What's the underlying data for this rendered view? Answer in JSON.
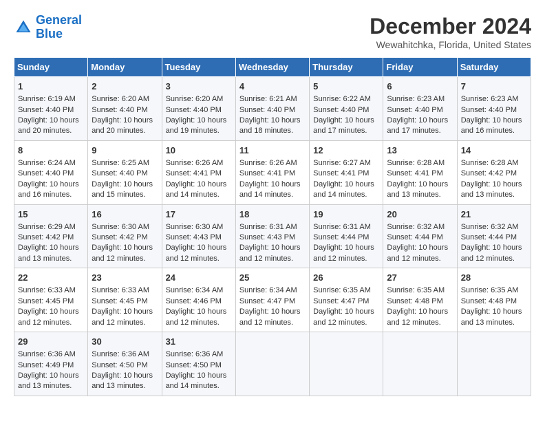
{
  "logo": {
    "line1": "General",
    "line2": "Blue"
  },
  "title": "December 2024",
  "subtitle": "Wewahitchka, Florida, United States",
  "columns": [
    "Sunday",
    "Monday",
    "Tuesday",
    "Wednesday",
    "Thursday",
    "Friday",
    "Saturday"
  ],
  "weeks": [
    [
      {
        "day": "1",
        "lines": [
          "Sunrise: 6:19 AM",
          "Sunset: 4:40 PM",
          "Daylight: 10 hours",
          "and 20 minutes."
        ]
      },
      {
        "day": "2",
        "lines": [
          "Sunrise: 6:20 AM",
          "Sunset: 4:40 PM",
          "Daylight: 10 hours",
          "and 20 minutes."
        ]
      },
      {
        "day": "3",
        "lines": [
          "Sunrise: 6:20 AM",
          "Sunset: 4:40 PM",
          "Daylight: 10 hours",
          "and 19 minutes."
        ]
      },
      {
        "day": "4",
        "lines": [
          "Sunrise: 6:21 AM",
          "Sunset: 4:40 PM",
          "Daylight: 10 hours",
          "and 18 minutes."
        ]
      },
      {
        "day": "5",
        "lines": [
          "Sunrise: 6:22 AM",
          "Sunset: 4:40 PM",
          "Daylight: 10 hours",
          "and 17 minutes."
        ]
      },
      {
        "day": "6",
        "lines": [
          "Sunrise: 6:23 AM",
          "Sunset: 4:40 PM",
          "Daylight: 10 hours",
          "and 17 minutes."
        ]
      },
      {
        "day": "7",
        "lines": [
          "Sunrise: 6:23 AM",
          "Sunset: 4:40 PM",
          "Daylight: 10 hours",
          "and 16 minutes."
        ]
      }
    ],
    [
      {
        "day": "8",
        "lines": [
          "Sunrise: 6:24 AM",
          "Sunset: 4:40 PM",
          "Daylight: 10 hours",
          "and 16 minutes."
        ]
      },
      {
        "day": "9",
        "lines": [
          "Sunrise: 6:25 AM",
          "Sunset: 4:40 PM",
          "Daylight: 10 hours",
          "and 15 minutes."
        ]
      },
      {
        "day": "10",
        "lines": [
          "Sunrise: 6:26 AM",
          "Sunset: 4:41 PM",
          "Daylight: 10 hours",
          "and 14 minutes."
        ]
      },
      {
        "day": "11",
        "lines": [
          "Sunrise: 6:26 AM",
          "Sunset: 4:41 PM",
          "Daylight: 10 hours",
          "and 14 minutes."
        ]
      },
      {
        "day": "12",
        "lines": [
          "Sunrise: 6:27 AM",
          "Sunset: 4:41 PM",
          "Daylight: 10 hours",
          "and 14 minutes."
        ]
      },
      {
        "day": "13",
        "lines": [
          "Sunrise: 6:28 AM",
          "Sunset: 4:41 PM",
          "Daylight: 10 hours",
          "and 13 minutes."
        ]
      },
      {
        "day": "14",
        "lines": [
          "Sunrise: 6:28 AM",
          "Sunset: 4:42 PM",
          "Daylight: 10 hours",
          "and 13 minutes."
        ]
      }
    ],
    [
      {
        "day": "15",
        "lines": [
          "Sunrise: 6:29 AM",
          "Sunset: 4:42 PM",
          "Daylight: 10 hours",
          "and 13 minutes."
        ]
      },
      {
        "day": "16",
        "lines": [
          "Sunrise: 6:30 AM",
          "Sunset: 4:42 PM",
          "Daylight: 10 hours",
          "and 12 minutes."
        ]
      },
      {
        "day": "17",
        "lines": [
          "Sunrise: 6:30 AM",
          "Sunset: 4:43 PM",
          "Daylight: 10 hours",
          "and 12 minutes."
        ]
      },
      {
        "day": "18",
        "lines": [
          "Sunrise: 6:31 AM",
          "Sunset: 4:43 PM",
          "Daylight: 10 hours",
          "and 12 minutes."
        ]
      },
      {
        "day": "19",
        "lines": [
          "Sunrise: 6:31 AM",
          "Sunset: 4:44 PM",
          "Daylight: 10 hours",
          "and 12 minutes."
        ]
      },
      {
        "day": "20",
        "lines": [
          "Sunrise: 6:32 AM",
          "Sunset: 4:44 PM",
          "Daylight: 10 hours",
          "and 12 minutes."
        ]
      },
      {
        "day": "21",
        "lines": [
          "Sunrise: 6:32 AM",
          "Sunset: 4:44 PM",
          "Daylight: 10 hours",
          "and 12 minutes."
        ]
      }
    ],
    [
      {
        "day": "22",
        "lines": [
          "Sunrise: 6:33 AM",
          "Sunset: 4:45 PM",
          "Daylight: 10 hours",
          "and 12 minutes."
        ]
      },
      {
        "day": "23",
        "lines": [
          "Sunrise: 6:33 AM",
          "Sunset: 4:45 PM",
          "Daylight: 10 hours",
          "and 12 minutes."
        ]
      },
      {
        "day": "24",
        "lines": [
          "Sunrise: 6:34 AM",
          "Sunset: 4:46 PM",
          "Daylight: 10 hours",
          "and 12 minutes."
        ]
      },
      {
        "day": "25",
        "lines": [
          "Sunrise: 6:34 AM",
          "Sunset: 4:47 PM",
          "Daylight: 10 hours",
          "and 12 minutes."
        ]
      },
      {
        "day": "26",
        "lines": [
          "Sunrise: 6:35 AM",
          "Sunset: 4:47 PM",
          "Daylight: 10 hours",
          "and 12 minutes."
        ]
      },
      {
        "day": "27",
        "lines": [
          "Sunrise: 6:35 AM",
          "Sunset: 4:48 PM",
          "Daylight: 10 hours",
          "and 12 minutes."
        ]
      },
      {
        "day": "28",
        "lines": [
          "Sunrise: 6:35 AM",
          "Sunset: 4:48 PM",
          "Daylight: 10 hours",
          "and 13 minutes."
        ]
      }
    ],
    [
      {
        "day": "29",
        "lines": [
          "Sunrise: 6:36 AM",
          "Sunset: 4:49 PM",
          "Daylight: 10 hours",
          "and 13 minutes."
        ]
      },
      {
        "day": "30",
        "lines": [
          "Sunrise: 6:36 AM",
          "Sunset: 4:50 PM",
          "Daylight: 10 hours",
          "and 13 minutes."
        ]
      },
      {
        "day": "31",
        "lines": [
          "Sunrise: 6:36 AM",
          "Sunset: 4:50 PM",
          "Daylight: 10 hours",
          "and 14 minutes."
        ]
      },
      null,
      null,
      null,
      null
    ]
  ]
}
